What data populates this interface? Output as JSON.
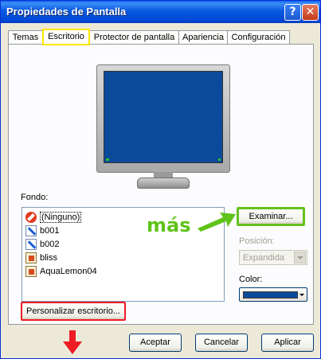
{
  "window": {
    "title": "Propiedades de Pantalla",
    "help_glyph": "?",
    "close_glyph": "✕"
  },
  "tabs": [
    {
      "label": "Temas"
    },
    {
      "label": "Escritorio",
      "active": true
    },
    {
      "label": "Protector de pantalla"
    },
    {
      "label": "Apariencia"
    },
    {
      "label": "Configuración"
    }
  ],
  "desktop": {
    "background_label": "Fondo:",
    "background_list": [
      {
        "label": "(Ninguno)",
        "icon": "no-entry-icon",
        "selected": true
      },
      {
        "label": "b001",
        "icon": "image-edit-icon"
      },
      {
        "label": "b002",
        "icon": "image-edit-icon"
      },
      {
        "label": "bliss",
        "icon": "image-file-icon"
      },
      {
        "label": "AquaLemon04",
        "icon": "image-file-icon"
      }
    ],
    "browse_label": "Examinar...",
    "position_label": "Posición:",
    "position_value": "Expandida",
    "color_label": "Color:",
    "color_value": "#0b4a9a",
    "customize_label": "Personalizar escritorio..."
  },
  "annotation": {
    "text": "más",
    "green": "#5fc31a",
    "red": "#ee1c24"
  },
  "footer": {
    "ok_label": "Aceptar",
    "cancel_label": "Cancelar",
    "apply_label": "Aplicar"
  }
}
